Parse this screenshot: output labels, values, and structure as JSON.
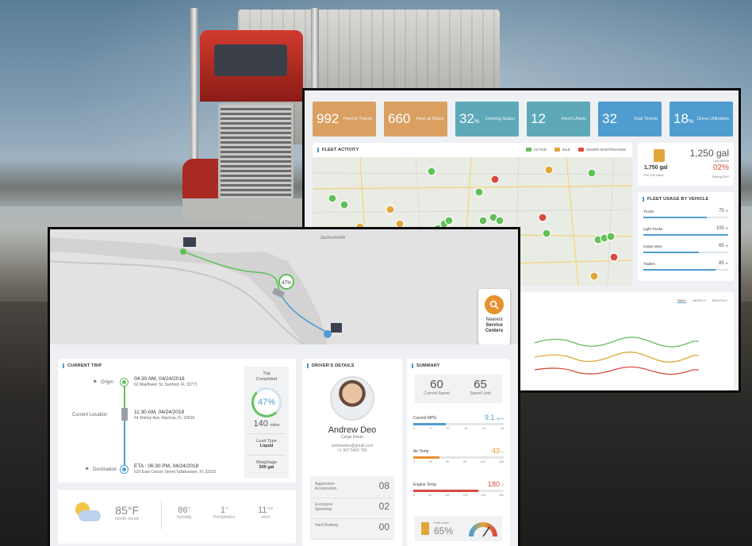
{
  "fleet": {
    "tiles": [
      {
        "value": "992",
        "label": "Fleet in Transit",
        "color": "orange"
      },
      {
        "value": "660",
        "label": "Fleet at Depot",
        "color": "orange"
      },
      {
        "value": "32",
        "unit": "%",
        "label": "Docking Status",
        "color": "teal"
      },
      {
        "value": "12",
        "label": "Fleet's Alerts",
        "color": "teal"
      },
      {
        "value": "32",
        "label": "Total Tickets",
        "color": "blue"
      },
      {
        "value": "18",
        "unit": "%",
        "label": "Driver Utilization",
        "color": "blue"
      }
    ],
    "activity_title": "FLEET ACTIVITY",
    "legend": [
      {
        "label": "ACTIVE",
        "color": "#62c05a"
      },
      {
        "label": "IDLE",
        "color": "#e0a63a"
      },
      {
        "label": "UNDER MAINTENANCE",
        "color": "#d94a3e"
      }
    ],
    "fuel": {
      "gallons": "1,750 gal",
      "per": "Per 100 miles",
      "last_month": "1,250 gal",
      "last_month_label": "Last Month",
      "change": "02%",
      "change_label": "Saving EVP"
    },
    "usage_title": "FLEET USAGE BY VEHICLE",
    "usage": [
      {
        "label": "Trucks",
        "value": "75",
        "unit": "%",
        "fraction": 0.75
      },
      {
        "label": "Light Trucks",
        "value": "100",
        "unit": "%",
        "fraction": 1.0
      },
      {
        "label": "Cargo Vans",
        "value": "65",
        "unit": "%",
        "fraction": 0.65
      },
      {
        "label": "Trailers",
        "value": "85",
        "unit": "%",
        "fraction": 0.85
      }
    ],
    "trend_tabs": [
      "DAILY",
      "WEEKLY",
      "MONTHLY"
    ]
  },
  "trip": {
    "service": {
      "line1": "Nearest",
      "line2": "Service",
      "line3": "Centers"
    },
    "route_progress": "47%",
    "current_trip_title": "CURRENT TRIP",
    "origin_label": "Origin",
    "origin_time": "04:30 AM, 04/24/2018",
    "origin_addr": "62 Mayflower St. Sanford, FL 32771",
    "current_label": "Current Location",
    "current_time": "11:30 AM, 04/24/2018",
    "current_addr": "44 Shirley Ave. Alachua, FL 32616",
    "dest_label": "Destination",
    "dest_time": "ETA : 06:30 PM, 04/24/2018",
    "dest_addr": "623 East Carson Street Tallahassee, FL 32310",
    "completed_label": "Trip Completed",
    "completed_value": "47%",
    "miles": "140",
    "miles_unit": "miles",
    "load_label": "Load Type",
    "load_value": "Liquid",
    "weightage_label": "Weightage",
    "weightage_value": "500 gal",
    "driver_title": "DRIVER'S DETAILS",
    "driver_name": "Andrew Deo",
    "driver_role": "Cargo Driver",
    "driver_email": "andrewdeo@gmail.com",
    "driver_phone": "+1 907 5456 785",
    "scores": [
      {
        "label": "Aggressive Acceleration",
        "value": "08"
      },
      {
        "label": "Excessive Speeding",
        "value": "02"
      },
      {
        "label": "Hard Braking",
        "value": "00"
      }
    ],
    "summary_title": "SUMMARY",
    "speed": "60",
    "speed_label": "Current Speed",
    "limit": "65",
    "limit_label": "Speed Limit",
    "mpg_label": "Current MPG",
    "mpg_value": "9.1",
    "mpg_unit": "MPG",
    "mpg_scale": [
      "0",
      "5",
      "10",
      "15",
      "20",
      "25"
    ],
    "air_label": "Air Temp",
    "air_value": "43",
    "air_unit": "F",
    "air_scale": [
      "0",
      "30",
      "60",
      "90",
      "120",
      "150"
    ],
    "engine_label": "Engine Temp",
    "engine_value": "180",
    "engine_unit": "F",
    "engine_scale": [
      "0",
      "50",
      "100",
      "150",
      "200",
      "250"
    ],
    "fuel_level_label": "Fuel Level",
    "fuel_level_value": "65%",
    "weather": {
      "temp": "85°F",
      "cond": "mostly clouds",
      "humidity": "86",
      "humidity_unit": "%",
      "humidity_label": "humidity",
      "precip": "1",
      "precip_unit": "%",
      "precip_label": "Precipitation",
      "wind": "11",
      "wind_unit": "mph",
      "wind_label": "wind"
    }
  },
  "colors": {
    "accent": "#4f9dd0",
    "green": "#62c05a",
    "orange": "#e8912e",
    "red": "#d94a3e"
  }
}
